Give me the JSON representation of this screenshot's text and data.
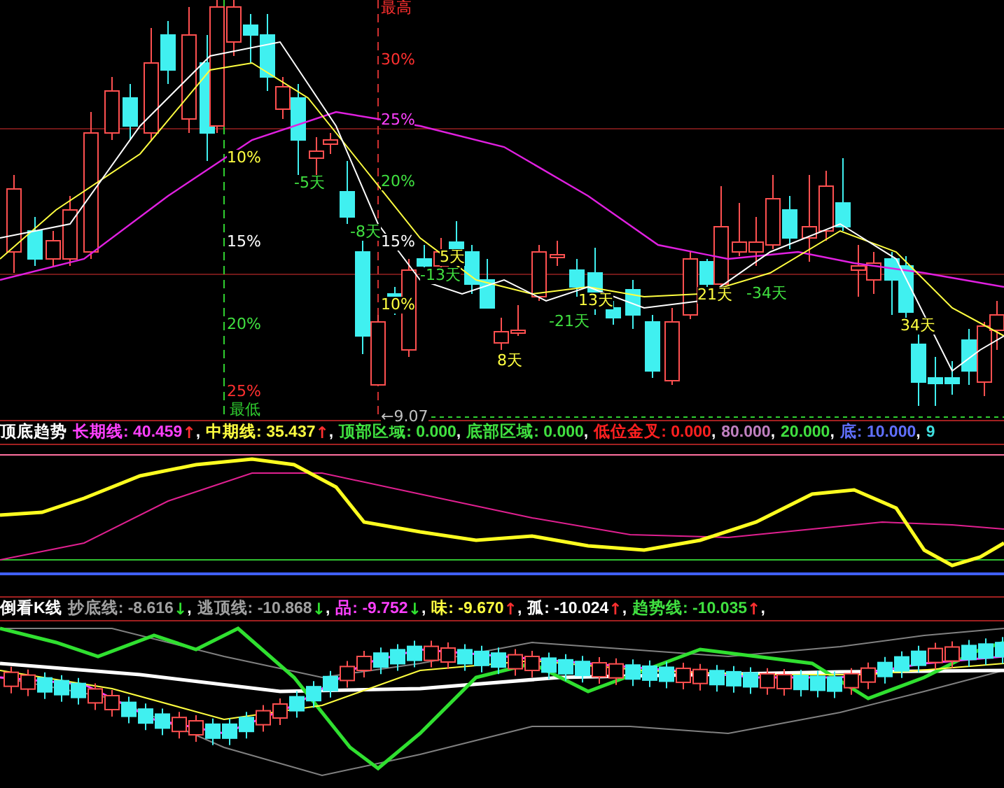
{
  "main_chart": {
    "high_label": "最高",
    "low_label": "最低",
    "low_price": "←9.07",
    "percent_marks": [
      {
        "text": "10%",
        "color": "#ffff40"
      },
      {
        "text": "15%",
        "color": "#ffffff"
      },
      {
        "text": "20%",
        "color": "#40e040"
      },
      {
        "text": "25%",
        "color": "#ff3030"
      },
      {
        "text": "30%",
        "color": "#ff3030"
      },
      {
        "text": "25%",
        "color": "#ff40ff"
      },
      {
        "text": "20%",
        "color": "#40e040"
      },
      {
        "text": "15%",
        "color": "#ffffff"
      },
      {
        "text": "10%",
        "color": "#ffff40"
      }
    ],
    "day_marks": [
      {
        "text": "-5天",
        "color": "#40e040"
      },
      {
        "text": "-8天",
        "color": "#40e040"
      },
      {
        "text": "-13天",
        "color": "#40e040"
      },
      {
        "text": "5天",
        "color": "#ffff40"
      },
      {
        "text": "8天",
        "color": "#ffff40"
      },
      {
        "text": "-21天",
        "color": "#40e040"
      },
      {
        "text": "13天",
        "color": "#ffff40"
      },
      {
        "text": "21天",
        "color": "#ffff40"
      },
      {
        "text": "-34天",
        "color": "#40e040"
      },
      {
        "text": "34天",
        "color": "#ffff40"
      }
    ]
  },
  "indicator_1": {
    "title": "顶底趋势",
    "items": [
      {
        "label": "长期线:",
        "value": "40.459",
        "arrow": {
          "text": "↑",
          "color": "#ff3030"
        },
        "suffix": ",",
        "color": "#ff40ff"
      },
      {
        "label": "中期线:",
        "value": "35.437",
        "arrow": {
          "text": "↑",
          "color": "#ff3030"
        },
        "suffix": ",",
        "color": "#ffff40"
      },
      {
        "label": "顶部区域:",
        "value": "0.000",
        "suffix": ",",
        "color": "#40e040"
      },
      {
        "label": "底部区域:",
        "value": "0.000",
        "suffix": ",",
        "color": "#40e040"
      },
      {
        "label": "低位金叉:",
        "value": "0.000",
        "suffix": ",",
        "color": "#ff2020"
      },
      {
        "value": "80.000",
        "suffix": ",",
        "color": "#c080c0"
      },
      {
        "value": "20.000",
        "suffix": ",",
        "color": "#40e040"
      },
      {
        "label": "底:",
        "value": "10.000",
        "suffix": ",",
        "color": "#6070ff"
      },
      {
        "value": "9",
        "color": "#40e0e0"
      }
    ]
  },
  "indicator_2": {
    "title": "倒看K线",
    "items": [
      {
        "label": "抄底线:",
        "value": "-8.616",
        "arrow": {
          "text": "↓",
          "color": "#30e030"
        },
        "suffix": ",",
        "color": "#a0a0a0"
      },
      {
        "label": "逃顶线:",
        "value": "-10.868",
        "arrow": {
          "text": "↓",
          "color": "#30e030"
        },
        "suffix": ",",
        "color": "#a0a0a0"
      },
      {
        "label": "品:",
        "value": "-9.752",
        "arrow": {
          "text": "↓",
          "color": "#30e030"
        },
        "suffix": ",",
        "color": "#ff40ff"
      },
      {
        "label": "味:",
        "value": "-9.670",
        "arrow": {
          "text": "↑",
          "color": "#ff3030"
        },
        "suffix": ",",
        "color": "#ffff40"
      },
      {
        "label": "孤:",
        "value": "-10.024",
        "arrow": {
          "text": "↑",
          "color": "#ff3030"
        },
        "suffix": ",",
        "color": "#ffffff"
      },
      {
        "label": "趋势线:",
        "value": "-10.035",
        "arrow": {
          "text": "↑",
          "color": "#ff3030"
        },
        "suffix": ",",
        "color": "#40e040"
      }
    ]
  }
}
